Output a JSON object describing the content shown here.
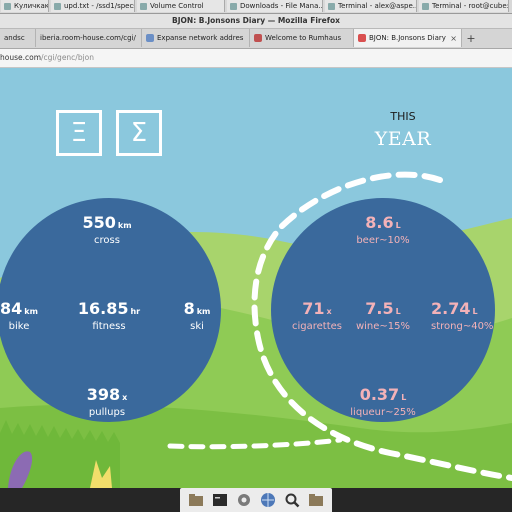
{
  "taskbar": {
    "items": [
      {
        "label": "Куличкак ..."
      },
      {
        "label": "upd.txt - /ssd1/specs/"
      },
      {
        "label": "Volume Control"
      },
      {
        "label": "Downloads - File Mana..."
      },
      {
        "label": "Terminal - alex@aspe..."
      },
      {
        "label": "Terminal - root@cube:~"
      }
    ]
  },
  "window": {
    "title": "BJON: B.Jonsons Diary — Mozilla Firefox"
  },
  "tabs": [
    {
      "label": "andsc",
      "active": false
    },
    {
      "label": "iberia.room-house.com/cgi/",
      "active": false
    },
    {
      "label": "Expanse network addres",
      "active": false
    },
    {
      "label": "Welcome to Rumhaus",
      "active": false
    },
    {
      "label": "BJON: B.Jonsons Diary",
      "active": true
    }
  ],
  "tab_new_label": "+",
  "address": {
    "host": "house.com",
    "path": "/cgi/genc/bjon"
  },
  "logo": {
    "left_glyph": "Ξ",
    "right_glyph": "Σ"
  },
  "this_year": {
    "this": "THIS",
    "year": "YEAR"
  },
  "left_stats": [
    {
      "value": "550",
      "unit": "km",
      "label": "cross"
    },
    {
      "value": "84",
      "unit": "km",
      "label": "bike"
    },
    {
      "value": "16.85",
      "unit": "hr",
      "label": "fitness"
    },
    {
      "value": "8",
      "unit": "km",
      "label": "ski"
    },
    {
      "value": "398",
      "unit": "x",
      "label": "pullups"
    }
  ],
  "right_stats": [
    {
      "value": "8.6",
      "unit": "L",
      "label": "beer~10%"
    },
    {
      "value": "71",
      "unit": "x",
      "label": "cigarettes"
    },
    {
      "value": "7.5",
      "unit": "L",
      "label": "wine~15%"
    },
    {
      "value": "2.74",
      "unit": "L",
      "label": "strong~40%"
    },
    {
      "value": "0.37",
      "unit": "L",
      "label": "liqueur~25%"
    }
  ],
  "colors": {
    "sky": "#8bc8dd",
    "circle": "#3a699c",
    "pink_text": "#f3b2b8",
    "hill_light": "#a8d46c",
    "hill_dark": "#7cbf43"
  },
  "dock": {
    "icons": [
      "folder-icon",
      "terminal-icon",
      "settings-icon",
      "browser-icon",
      "search-icon",
      "folder-icon"
    ]
  }
}
